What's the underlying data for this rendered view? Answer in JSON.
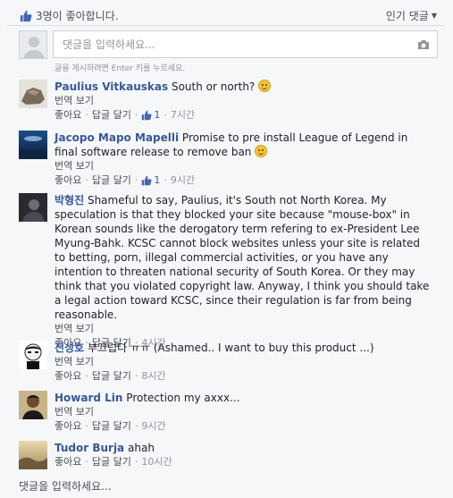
{
  "header": {
    "likes_text": "3명이 좋아합니다.",
    "sort_label": "인기 댓글"
  },
  "composer": {
    "placeholder": "댓글을 입력하세요...",
    "hint": "글을 게시하려면 Enter 키를 누르세요."
  },
  "labels": {
    "translate": "번역 보기",
    "like": "좋아요",
    "reply": "답글 달기",
    "dot": "·"
  },
  "comments": [
    {
      "author": "Paulius Vitkauskas",
      "text": "South or north?",
      "likes": "1",
      "time": "7시간"
    },
    {
      "author": "Jacopo Mapo Mapelli",
      "text": "Promise to pre install League of Legend in final software release to remove ban",
      "likes": "1",
      "time": "9시간"
    },
    {
      "author": "박형진",
      "text": "Shameful to say, Paulius, it's South not North Korea. My speculation is that they blocked your site because \"mouse-box\" in Korean sounds like the derogatory term refering to ex-President Lee Myung-Bahk. KCSC cannot block websites unless your site is related to betting, porn, illegal commercial activities, or you have any intention to threaten national security of South Korea. Or they may think that you violated copyright law. Anyway, I think you should take a legal action toward KCSC, since their regulation is far from being reasonable.",
      "time": "4시간"
    },
    {
      "author": "진성호",
      "text": "부끄럽다 ㅠㅠ (Ashamed.. I want to buy this product ...)",
      "time": "8시간"
    },
    {
      "author": "Howard Lin",
      "text": "Protection my axxx...",
      "time": "9시간"
    },
    {
      "author": "Tudor Burja",
      "text": "ahah",
      "time": "10시간"
    }
  ],
  "footer": {
    "placeholder": "댓글을 입력하세요..."
  },
  "colors": {
    "link": "#365899",
    "background": "#f6f7f9",
    "muted": "#90949c"
  }
}
